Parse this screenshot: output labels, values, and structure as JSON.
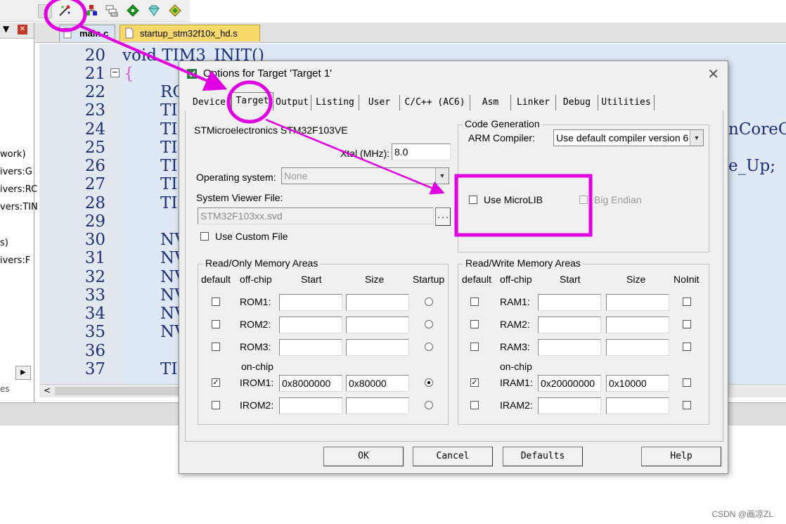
{
  "watermark": "CSDN @画凉ZL",
  "left_panel": {
    "pin_icon": "pin-icon",
    "close_icon": "close-icon",
    "items": [
      "work)",
      "ivers:G",
      "ivers:RC",
      "vers:TIN",
      "s)",
      "ivers:F"
    ],
    "bottom_tab": "es"
  },
  "tabs": [
    {
      "label": "main.c"
    },
    {
      "label": "startup_stm32f10x_hd.s"
    }
  ],
  "editor": {
    "line_numbers": [
      "20",
      "21",
      "22",
      "23",
      "24",
      "25",
      "26",
      "27",
      "28",
      "29",
      "30",
      "31",
      "32",
      "33",
      "34",
      "35",
      "36",
      "37"
    ],
    "code_line_20": "void TIM3_INIT()",
    "code_line_21": "{",
    "code_fragments_rc": "RC",
    "code_fragments_ti": "TI",
    "code_fragments_nv": "NV",
    "right_fragment_1": "nCoreCl",
    "right_fragment_2": "e_Up;"
  },
  "dialog": {
    "title": "Options for Target 'Target 1'",
    "tabs": [
      "Device",
      "Target",
      "Output",
      "Listing",
      "User",
      "C/C++ (AC6)",
      "Asm",
      "Linker",
      "Debug",
      "Utilities"
    ],
    "active_tab": "Target",
    "device_name": "STMicroelectronics STM32F103VE",
    "xtal_label": "Xtal (MHz):",
    "xtal_value": "8.0",
    "os_label": "Operating system:",
    "os_value": "None",
    "svf_label": "System Viewer File:",
    "svf_value": "STM32F103xx.svd",
    "browse_label": "...",
    "use_custom_file": "Use Custom File",
    "code_generation": {
      "group_label": "Code Generation",
      "compiler_label": "ARM Compiler:",
      "compiler_value": "Use default compiler version 6",
      "use_microlib": "Use MicroLIB",
      "big_endian": "Big Endian"
    },
    "ro_memory": {
      "group_label": "Read/Only Memory Areas",
      "headers": {
        "default": "default",
        "offchip": "off-chip",
        "start": "Start",
        "size": "Size",
        "startup": "Startup"
      },
      "onchip_label": "on-chip",
      "rows": [
        {
          "name": "ROM1:",
          "start": "",
          "size": "",
          "default": false,
          "startup": false
        },
        {
          "name": "ROM2:",
          "start": "",
          "size": "",
          "default": false,
          "startup": false
        },
        {
          "name": "ROM3:",
          "start": "",
          "size": "",
          "default": false,
          "startup": false
        },
        {
          "name": "IROM1:",
          "start": "0x8000000",
          "size": "0x80000",
          "default": true,
          "startup": true
        },
        {
          "name": "IROM2:",
          "start": "",
          "size": "",
          "default": false,
          "startup": false
        }
      ]
    },
    "rw_memory": {
      "group_label": "Read/Write Memory Areas",
      "headers": {
        "default": "default",
        "offchip": "off-chip",
        "start": "Start",
        "size": "Size",
        "noinit": "NoInit"
      },
      "onchip_label": "on-chip",
      "rows": [
        {
          "name": "RAM1:",
          "start": "",
          "size": "",
          "default": false,
          "noinit": false
        },
        {
          "name": "RAM2:",
          "start": "",
          "size": "",
          "default": false,
          "noinit": false
        },
        {
          "name": "RAM3:",
          "start": "",
          "size": "",
          "default": false,
          "noinit": false
        },
        {
          "name": "IRAM1:",
          "start": "0x20000000",
          "size": "0x10000",
          "default": true,
          "noinit": false
        },
        {
          "name": "IRAM2:",
          "start": "",
          "size": "",
          "default": false,
          "noinit": false
        }
      ]
    },
    "buttons": {
      "ok": "OK",
      "cancel": "Cancel",
      "defaults": "Defaults",
      "help": "Help"
    }
  },
  "annotation_color": "#e100e1"
}
